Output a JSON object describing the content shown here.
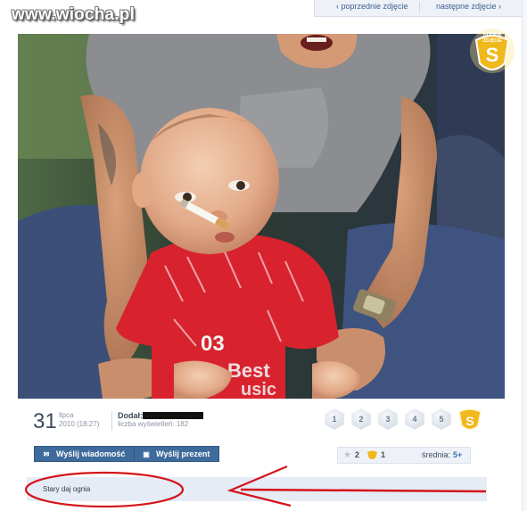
{
  "watermark": "www.wiocha.pl",
  "nav": {
    "prev_label": "‹ poprzednie zdjęcie",
    "next_label": "następne zdjęcie ›"
  },
  "badge": {
    "top_text": "SUPER",
    "bottom_text": "ZDJĘCIE",
    "letter": "S"
  },
  "meta": {
    "day": "31",
    "month": "lipca",
    "datetime": "2010 (18:27)",
    "added_label": "Dodał:",
    "views_label": "liczba wyświetleń:",
    "views_value": "182"
  },
  "rating": {
    "stars": [
      "1",
      "2",
      "3",
      "4",
      "5"
    ],
    "super_letter": "S"
  },
  "buttons": {
    "send_message": "Wyślij wiadomość",
    "send_gift": "Wyślij prezent"
  },
  "votes": {
    "count_stars": "2",
    "count_super": "1",
    "average_label": "średnia:",
    "average_value": "5+"
  },
  "comment": {
    "text": "Stary daj ognia"
  },
  "colors": {
    "accent": "#3f6b9c",
    "annotation": "#d4141b",
    "gold": "#f0b81c",
    "comment_bg": "#e5ecf6"
  }
}
